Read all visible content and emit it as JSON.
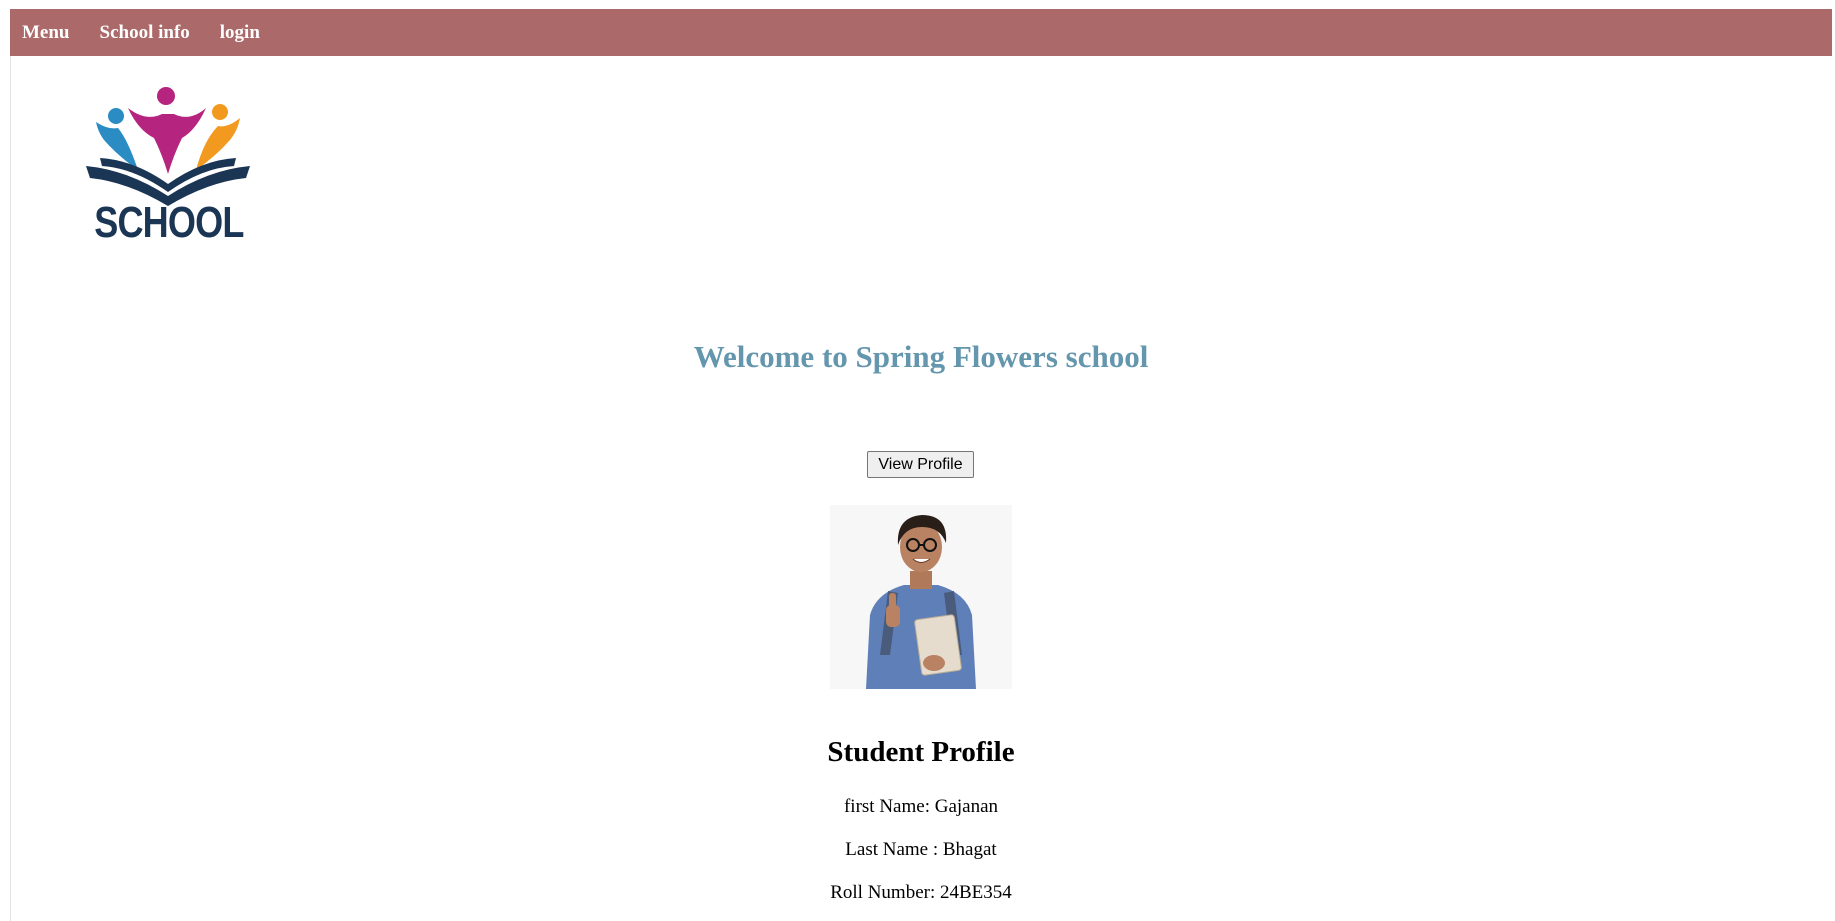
{
  "navbar": {
    "items": [
      {
        "label": "Menu"
      },
      {
        "label": "School info"
      },
      {
        "label": "login"
      }
    ],
    "background_color": "#ab6969"
  },
  "logo": {
    "text": "SCHOOL",
    "colors": [
      "#b5247e",
      "#2b8cc4",
      "#f29a1f",
      "#1b3554"
    ]
  },
  "welcome": {
    "heading": "Welcome to Spring Flowers school",
    "color": "#6496ae"
  },
  "actions": {
    "view_profile_label": "View Profile"
  },
  "profile": {
    "title": "Student Profile",
    "first_name_line": "first Name: Gajanan",
    "last_name_line": "Last Name : Bhagat",
    "roll_number_line": "Roll Number: 24BE354"
  }
}
